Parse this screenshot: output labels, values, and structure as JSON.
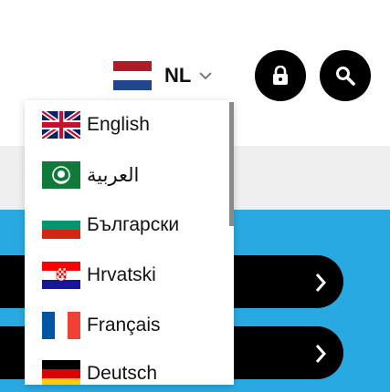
{
  "header": {
    "current_language": "NL"
  },
  "language_menu": {
    "items": [
      {
        "label": "English",
        "flag": "uk-flag-icon"
      },
      {
        "label": "العربية",
        "flag": "arab-league-flag-icon"
      },
      {
        "label": "Български",
        "flag": "bulgaria-flag-icon"
      },
      {
        "label": "Hrvatski",
        "flag": "croatia-flag-icon"
      },
      {
        "label": "Français",
        "flag": "france-flag-icon"
      },
      {
        "label": "Deutsch",
        "flag": "germany-flag-icon"
      }
    ]
  },
  "colors": {
    "accent_blue": "#29a9e1",
    "band_grey": "#efefef",
    "button_black": "#000000"
  },
  "icons": [
    "chevron-down-icon",
    "lock-icon",
    "search-icon",
    "chevron-right-icon"
  ]
}
